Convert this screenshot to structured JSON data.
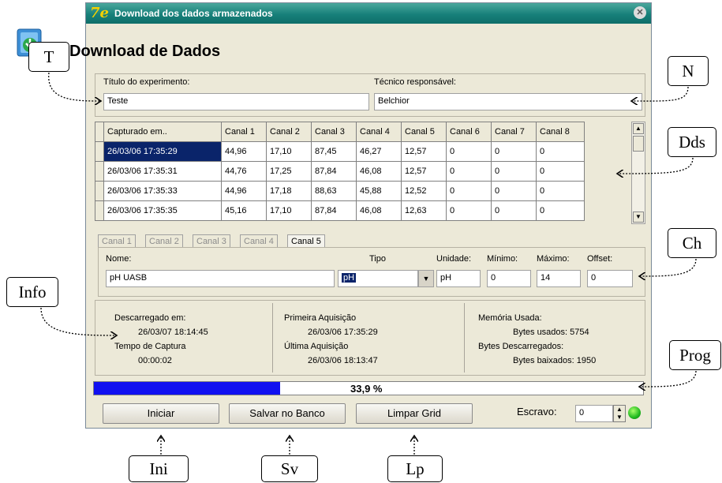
{
  "window": {
    "title": "Download dos dados armazenados",
    "app_icon": "7e"
  },
  "header": {
    "title": "Download de Dados"
  },
  "experiment": {
    "title_label": "Título do experimento:",
    "title_value": "Teste",
    "tech_label": "Técnico responsável:",
    "tech_value": "Belchior"
  },
  "table": {
    "headers": [
      "Capturado em..",
      "Canal 1",
      "Canal 2",
      "Canal 3",
      "Canal 4",
      "Canal 5",
      "Canal 6",
      "Canal 7",
      "Canal 8"
    ],
    "rows": [
      [
        "26/03/06 17:35:29",
        "44,96",
        "17,10",
        "87,45",
        "46,27",
        "12,57",
        "0",
        "0",
        "0"
      ],
      [
        "26/03/06 17:35:31",
        "44,76",
        "17,25",
        "87,84",
        "46,08",
        "12,57",
        "0",
        "0",
        "0"
      ],
      [
        "26/03/06 17:35:33",
        "44,96",
        "17,18",
        "88,63",
        "45,88",
        "12,52",
        "0",
        "0",
        "0"
      ],
      [
        "26/03/06 17:35:35",
        "45,16",
        "17,10",
        "87,84",
        "46,08",
        "12,63",
        "0",
        "0",
        "0"
      ]
    ]
  },
  "tabs": [
    "Canal 1",
    "Canal 2",
    "Canal 3",
    "Canal 4",
    "Canal 5"
  ],
  "channel": {
    "name_label": "Nome:",
    "name_value": "pH UASB",
    "type_label": "Tipo",
    "type_value": "pH",
    "unit_label": "Unidade:",
    "unit_value": "pH",
    "min_label": "Mínimo:",
    "min_value": "0",
    "max_label": "Máximo:",
    "max_value": "14",
    "offset_label": "Offset:",
    "offset_value": "0"
  },
  "info": {
    "downloaded_label": "Descarregado em:",
    "downloaded_value": "26/03/07 18:14:45",
    "capture_time_label": "Tempo de Captura",
    "capture_time_value": "00:00:02",
    "first_label": "Primeira Aquisição",
    "first_value": "26/03/06 17:35:29",
    "last_label": "Última Aquisição",
    "last_value": "26/03/06 18:13:47",
    "memory_label": "Memória Usada:",
    "bytes_used": "Bytes usados: 5754",
    "downloaded_bytes_label": "Bytes Descarregados:",
    "bytes_downloaded": "Bytes baixados: 1950"
  },
  "progress": {
    "value": 0.339,
    "text": "33,9 %",
    "color": "#1010f0"
  },
  "buttons": {
    "start": "Iniciar",
    "save": "Salvar no Banco",
    "clear": "Limpar Grid"
  },
  "slave": {
    "label": "Escravo:",
    "value": "0"
  },
  "status_led_color": "#1fb91f",
  "callouts": {
    "T": "T",
    "N": "N",
    "Dds": "Dds",
    "Ch": "Ch",
    "Info": "Info",
    "Prog": "Prog",
    "Ini": "Ini",
    "Sv": "Sv",
    "Lp": "Lp"
  }
}
